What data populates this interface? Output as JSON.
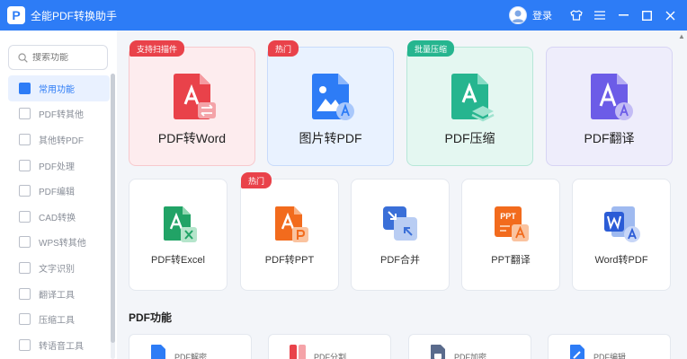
{
  "app": {
    "title": "全能PDF转换助手",
    "logo_letter": "P",
    "login_label": "登录"
  },
  "window_controls": {
    "skin": "👕",
    "menu": "≡",
    "minimize": "—",
    "maximize": "☐",
    "close": "✕"
  },
  "search": {
    "placeholder": "搜索功能"
  },
  "sidebar": {
    "items": [
      {
        "label": "常用功能",
        "active": true
      },
      {
        "label": "PDF转其他"
      },
      {
        "label": "其他转PDF"
      },
      {
        "label": "PDF处理"
      },
      {
        "label": "PDF编辑"
      },
      {
        "label": "CAD转换"
      },
      {
        "label": "WPS转其他"
      },
      {
        "label": "文字识别"
      },
      {
        "label": "翻译工具"
      },
      {
        "label": "压缩工具"
      },
      {
        "label": "转语音工具"
      }
    ]
  },
  "featured": [
    {
      "label": "PDF转Word",
      "tag": "支持扫描件",
      "tag_color": "#e9424a",
      "bg": "#fdecee",
      "border": "#f7c9cd",
      "icon": "pdf-to-word-icon",
      "icon_color": "#e9424a"
    },
    {
      "label": "图片转PDF",
      "tag": "热门",
      "tag_color": "#e9424a",
      "bg": "#e9f2ff",
      "border": "#c8dbfb",
      "icon": "image-to-pdf-icon",
      "icon_color": "#2d7cf6"
    },
    {
      "label": "PDF压缩",
      "tag": "批量压缩",
      "tag_color": "#26b58f",
      "bg": "#e4f7f1",
      "border": "#b7e7d8",
      "icon": "pdf-compress-icon",
      "icon_color": "#26b58f"
    },
    {
      "label": "PDF翻译",
      "tag": "",
      "tag_color": "",
      "bg": "#eeedfb",
      "border": "#d7d4f4",
      "icon": "pdf-translate-icon",
      "icon_color": "#6c5ce7"
    }
  ],
  "tools": [
    {
      "label": "PDF转Excel",
      "tag": "",
      "icon": "pdf-to-excel-icon",
      "icon_color": "#21a366",
      "badge": "X"
    },
    {
      "label": "PDF转PPT",
      "tag": "热门",
      "icon": "pdf-to-ppt-icon",
      "icon_color": "#f26b1d",
      "badge": "P"
    },
    {
      "label": "PDF合并",
      "tag": "",
      "icon": "pdf-merge-icon",
      "icon_color": "#3a6fd8",
      "badge": ""
    },
    {
      "label": "PPT翻译",
      "tag": "",
      "icon": "ppt-translate-icon",
      "icon_color": "#f26b1d",
      "badge": "PPT"
    },
    {
      "label": "Word转PDF",
      "tag": "",
      "icon": "word-to-pdf-icon",
      "icon_color": "#2b5cd6",
      "badge": "W"
    }
  ],
  "pdf_section": {
    "title": "PDF功能",
    "items": [
      {
        "label": "PDF解密",
        "icon": "pdf-decrypt-icon",
        "icon_color": "#2d7cf6"
      },
      {
        "label": "PDF分割",
        "icon": "pdf-split-icon",
        "icon_color": "#e9424a"
      },
      {
        "label": "PDF加密",
        "icon": "pdf-encrypt-icon",
        "icon_color": "#5a6b8c"
      },
      {
        "label": "PDF编辑",
        "icon": "pdf-edit-icon",
        "icon_color": "#2d7cf6"
      }
    ]
  }
}
